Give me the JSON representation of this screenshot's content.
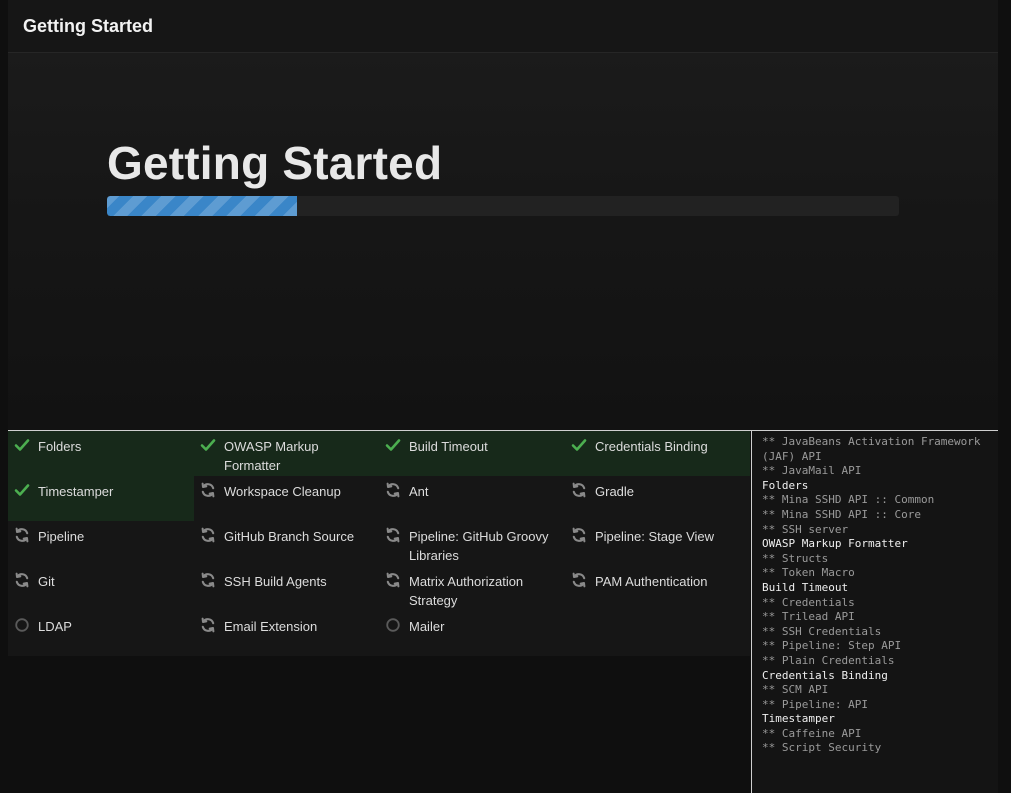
{
  "header": {
    "title": "Getting Started"
  },
  "main": {
    "title": "Getting Started",
    "progress": 0.24
  },
  "colors": {
    "success_bg": "#17291a",
    "check": "#4caf50",
    "progress": "#3a86c8",
    "spinner": "#8a8a8a"
  },
  "plugins": [
    {
      "name": "Folders",
      "status": "done",
      "icon": "check-icon"
    },
    {
      "name": "OWASP Markup Formatter",
      "status": "done",
      "icon": "check-icon"
    },
    {
      "name": "Build Timeout",
      "status": "done",
      "icon": "check-icon"
    },
    {
      "name": "Credentials Binding",
      "status": "done",
      "icon": "check-icon"
    },
    {
      "name": "Timestamper",
      "status": "done",
      "icon": "check-icon"
    },
    {
      "name": "Workspace Cleanup",
      "status": "installing",
      "icon": "refresh-icon"
    },
    {
      "name": "Ant",
      "status": "installing",
      "icon": "refresh-icon"
    },
    {
      "name": "Gradle",
      "status": "installing",
      "icon": "refresh-icon"
    },
    {
      "name": "Pipeline",
      "status": "installing",
      "icon": "refresh-icon"
    },
    {
      "name": "GitHub Branch Source",
      "status": "installing",
      "icon": "refresh-icon"
    },
    {
      "name": "Pipeline: GitHub Groovy Libraries",
      "status": "installing",
      "icon": "refresh-icon"
    },
    {
      "name": "Pipeline: Stage View",
      "status": "installing",
      "icon": "refresh-icon"
    },
    {
      "name": "Git",
      "status": "installing",
      "icon": "refresh-icon"
    },
    {
      "name": "SSH Build Agents",
      "status": "installing",
      "icon": "refresh-icon"
    },
    {
      "name": "Matrix Authorization Strategy",
      "status": "installing",
      "icon": "refresh-icon"
    },
    {
      "name": "PAM Authentication",
      "status": "installing",
      "icon": "refresh-icon"
    },
    {
      "name": "LDAP",
      "status": "pending",
      "icon": "circle-icon"
    },
    {
      "name": "Email Extension",
      "status": "installing",
      "icon": "refresh-icon"
    },
    {
      "name": "Mailer",
      "status": "pending",
      "icon": "circle-icon"
    }
  ],
  "log": [
    {
      "text": "** JavaBeans Activation Framework (JAF) API",
      "kind": "dep"
    },
    {
      "text": "** JavaMail API",
      "kind": "dep"
    },
    {
      "text": "Folders",
      "kind": "head"
    },
    {
      "text": "** Mina SSHD API :: Common",
      "kind": "dep"
    },
    {
      "text": "** Mina SSHD API :: Core",
      "kind": "dep"
    },
    {
      "text": "** SSH server",
      "kind": "dep"
    },
    {
      "text": "OWASP Markup Formatter",
      "kind": "head"
    },
    {
      "text": "** Structs",
      "kind": "dep"
    },
    {
      "text": "** Token Macro",
      "kind": "dep"
    },
    {
      "text": "Build Timeout",
      "kind": "head"
    },
    {
      "text": "** Credentials",
      "kind": "dep"
    },
    {
      "text": "** Trilead API",
      "kind": "dep"
    },
    {
      "text": "** SSH Credentials",
      "kind": "dep"
    },
    {
      "text": "** Pipeline: Step API",
      "kind": "dep"
    },
    {
      "text": "** Plain Credentials",
      "kind": "dep"
    },
    {
      "text": "Credentials Binding",
      "kind": "head"
    },
    {
      "text": "** SCM API",
      "kind": "dep"
    },
    {
      "text": "** Pipeline: API",
      "kind": "dep"
    },
    {
      "text": "Timestamper",
      "kind": "head"
    },
    {
      "text": "** Caffeine API",
      "kind": "dep"
    },
    {
      "text": "** Script Security",
      "kind": "dep"
    }
  ]
}
